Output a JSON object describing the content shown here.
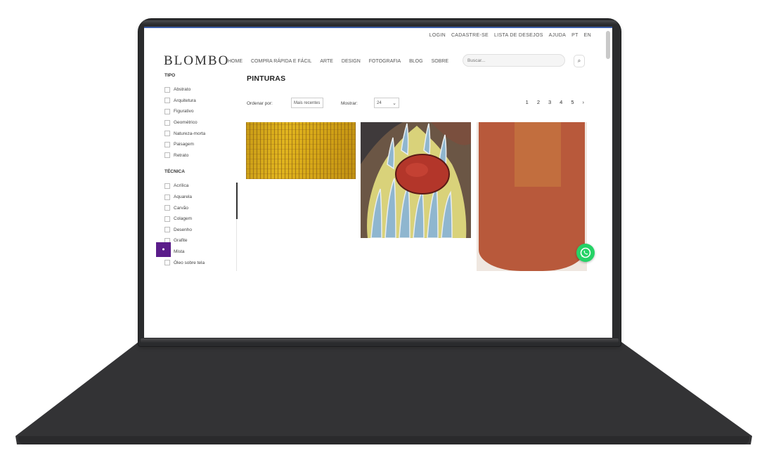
{
  "topbar": {
    "links": [
      "LOGIN",
      "CADASTRE-SE",
      "LISTA DE DESEJOS",
      "AJUDA",
      "PT",
      "EN"
    ]
  },
  "header": {
    "logo": "BLOMBO",
    "nav": [
      "Home",
      "Compra Rápida e Fácil",
      "Arte",
      "Design",
      "Fotografia",
      "Blog",
      "Sobre"
    ],
    "search_placeholder": "Buscar...",
    "search_icon": "search-icon"
  },
  "sidebar": {
    "category_heading": "Tipo",
    "categories": [
      "Abstrato",
      "Arquitetura",
      "Figurativo",
      "Geométrico",
      "Natureza-morta",
      "Paisagem",
      "Retrato"
    ],
    "filter_heading": "Técnica",
    "filters": [
      "Acrílica",
      "Aquarela",
      "Carvão",
      "Colagem",
      "Desenho",
      "Grafite",
      "Mista",
      "Óleo sobre tela"
    ]
  },
  "main": {
    "title": "PINTURAS",
    "sort_label": "Ordenar por:",
    "sort_value": "Mais recentes",
    "show_label": "Mostrar:",
    "show_value": "24",
    "pages": [
      "1",
      "2",
      "3",
      "4",
      "5"
    ],
    "next_icon": "chevron-right-icon"
  },
  "products": [
    {
      "name": "Pintura abstrata amarela",
      "alt": "Pintura abstrata amarela"
    },
    {
      "name": "Pintura figurativa",
      "alt": "Pintura figurativa"
    },
    {
      "name": "Cerâmica terracota",
      "alt": "Cerâmica terracota"
    }
  ],
  "colors": {
    "accent_blue": "#3c5ea8",
    "chat_purple": "#5a1c8a",
    "whatsapp_green": "#25d366",
    "laptop_body": "#2a2b2d"
  },
  "chat_widget_icon": "chat-icon",
  "whatsapp_icon": "whatsapp-icon"
}
